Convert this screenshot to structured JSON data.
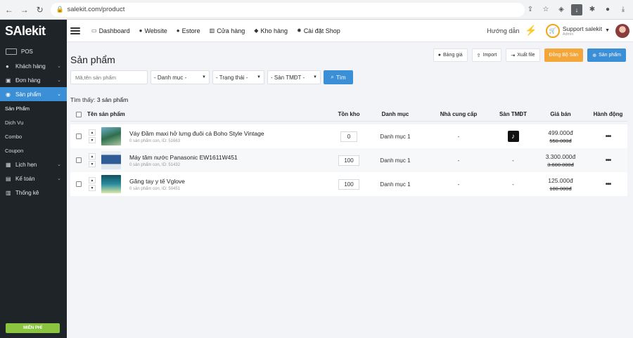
{
  "browser": {
    "url": "salekit.com/product"
  },
  "sidebar": {
    "logo": "SAlekit",
    "pos_label": "POS",
    "items": [
      {
        "label": "Khách hàng",
        "icon": "person-icon"
      },
      {
        "label": "Đơn hàng",
        "icon": "cart-icon"
      },
      {
        "label": "Sản phẩm",
        "icon": "product-icon"
      },
      {
        "label": "Lịch hẹn",
        "icon": "calendar-icon"
      },
      {
        "label": "Kế toán",
        "icon": "accounting-icon"
      },
      {
        "label": "Thống kê",
        "icon": "chart-icon"
      }
    ],
    "sub_items": [
      "Sản Phẩm",
      "Dịch Vụ",
      "Combo",
      "Coupon"
    ],
    "trial_label": "MIỄN PHÍ"
  },
  "topnav": {
    "links": [
      "Dashboard",
      "Website",
      "Estore",
      "Cửa hàng",
      "Kho hàng",
      "Cài đặt Shop"
    ],
    "guide": "Hướng dẫn",
    "support_name": "Support salekit",
    "support_role": "Admin"
  },
  "page": {
    "title": "Sản phẩm",
    "actions": [
      "Bảng giá",
      "Import",
      "Xuất file",
      "Đồng Bộ Sàn",
      "Sản phẩm"
    ],
    "filters": {
      "search_placeholder": "Mã,tên sản phẩm",
      "category": "- Danh mục -",
      "status": "- Trạng thái -",
      "marketplace": "- Sàn TMĐT -",
      "search_button": "Tìm"
    },
    "found_prefix": "Tìm thấy:",
    "found_count": "3 sản phẩm"
  },
  "table": {
    "headers": [
      "Tên sản phẩm",
      "Tồn kho",
      "Danh mục",
      "Nhà cung cấp",
      "Sàn TMĐT",
      "Giá bán",
      "Hành động"
    ],
    "rows": [
      {
        "name": "Váy Đầm maxi hở lưng đuôi cá Boho Style Vintage",
        "sub": "0 sản phẩm con, ID: 51663",
        "stock": "0",
        "category": "Danh mục 1",
        "supplier": "-",
        "tmdt": "tiktok",
        "price": "499.000đ",
        "old_price": "550.000đ",
        "action": "•••"
      },
      {
        "name": "Máy tăm nước Panasonic EW1611W451",
        "sub": "0 sản phẩm con, ID: 51432",
        "stock": "100",
        "category": "Danh mục 1",
        "supplier": "-",
        "tmdt": "-",
        "price": "3.300.000đ",
        "old_price": "3.600.000đ",
        "action": "•••"
      },
      {
        "name": "Găng tay y tế Vglove",
        "sub": "0 sản phẩm con, ID: 50451",
        "stock": "100",
        "category": "Danh mục 1",
        "supplier": "-",
        "tmdt": "-",
        "price": "125.000đ",
        "old_price": "180.000đ",
        "action": "•••"
      }
    ]
  }
}
